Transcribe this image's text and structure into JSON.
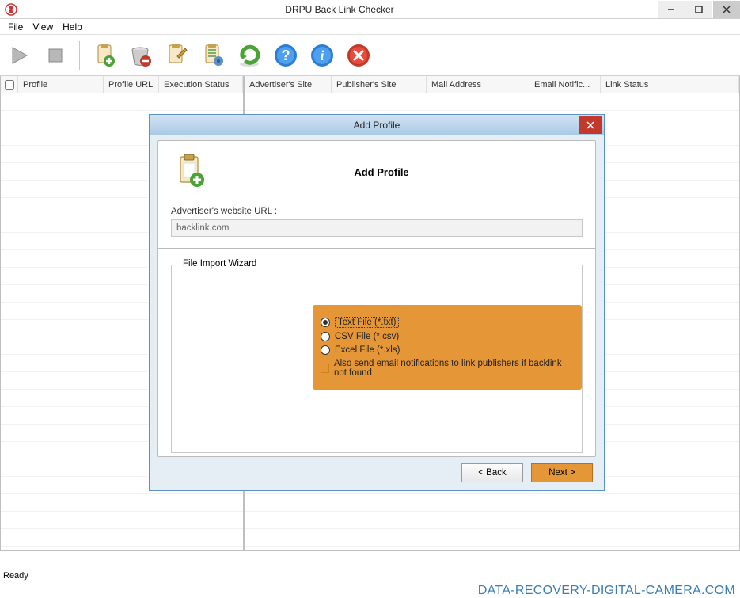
{
  "window": {
    "title": "DRPU Back Link Checker",
    "menubar": [
      "File",
      "View",
      "Help"
    ],
    "status": "Ready"
  },
  "toolbar": {
    "items": [
      "play",
      "stop",
      "add-profile",
      "delete-profile",
      "edit-profile",
      "settings",
      "refresh",
      "help",
      "info",
      "close"
    ]
  },
  "left_columns": {
    "profile": "Profile",
    "profile_url": "Profile URL",
    "exec_status": "Execution Status"
  },
  "right_columns": {
    "adv_site": "Advertiser's Site",
    "pub_site": "Publisher's Site",
    "mail": "Mail Address",
    "email_notif": "Email Notific...",
    "link_status": "Link Status"
  },
  "dialog": {
    "title": "Add Profile",
    "header": "Add Profile",
    "url_label": "Advertiser's website URL :",
    "url_value": "backlink.com",
    "fieldset_legend": "File Import Wizard",
    "opt_txt": "Text File (*.txt)",
    "opt_csv": "CSV File (*.csv)",
    "opt_xls": "Excel File (*.xls)",
    "opt_email": "Also send email notifications to link publishers if backlink not found",
    "back": "< Back",
    "next": "Next >"
  },
  "watermark": "DATA-RECOVERY-DIGITAL-CAMERA.COM"
}
